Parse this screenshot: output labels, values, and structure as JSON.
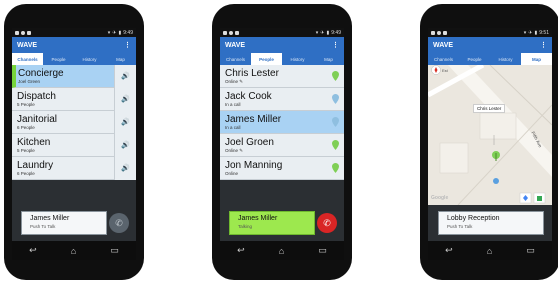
{
  "app": {
    "title": "WAVE",
    "menu_icon": "overflow-menu-icon"
  },
  "tabs": [
    "Channels",
    "People",
    "History",
    "Map"
  ],
  "status_bar": {
    "time": "9:49",
    "time_map": "9:51"
  },
  "phone1": {
    "channels": [
      {
        "name": "Concierge",
        "sub": "Joel Green"
      },
      {
        "name": "Dispatch",
        "sub": "5 People"
      },
      {
        "name": "Janitorial",
        "sub": "6 People"
      },
      {
        "name": "Kitchen",
        "sub": "5 People"
      },
      {
        "name": "Laundry",
        "sub": "6 People"
      }
    ],
    "ptt": {
      "name": "James Miller",
      "state": "Push To Talk"
    }
  },
  "phone2": {
    "people": [
      {
        "name": "Chris Lester",
        "sub": "Online ✎"
      },
      {
        "name": "Jack Cook",
        "sub": "In a call"
      },
      {
        "name": "James Miller",
        "sub": "In a call"
      },
      {
        "name": "Joel Groen",
        "sub": "Online ✎"
      },
      {
        "name": "Jon Manning",
        "sub": "Online"
      }
    ],
    "ptt": {
      "name": "James Miller",
      "state": "Talking"
    }
  },
  "phone3": {
    "map_label_callout": "Chris Lester",
    "street_label": "Fifth Ave",
    "compass_label": "Est",
    "google_label": "Google",
    "ptt": {
      "name": "Lobby Reception",
      "state": "Push To Talk"
    }
  },
  "colors": {
    "appbar": "#2f6fc4",
    "selected_row": "#a9d2f3",
    "talking": "#9de84e",
    "end_call": "#d92525"
  }
}
